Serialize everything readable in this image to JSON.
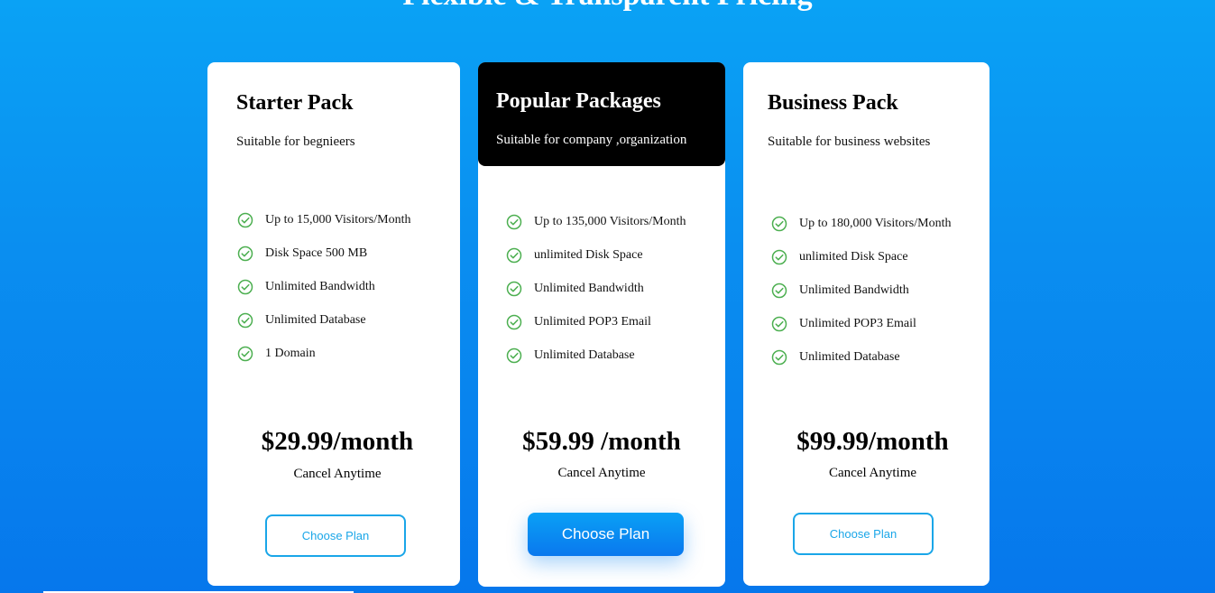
{
  "page": {
    "heading": "Flexible & Transparent Pricing"
  },
  "plans": [
    {
      "title": "Starter Pack",
      "description": "Suitable for begnieers",
      "features": [
        "Up to 15,000 Visitors/Month",
        "Disk Space 500 MB",
        "Unlimited Bandwidth",
        "Unlimited Database",
        "1 Domain"
      ],
      "price": "$29.99/month",
      "cancel_note": "Cancel Anytime",
      "button_label": "Choose Plan"
    },
    {
      "title": "Popular Packages",
      "description": "Suitable for company ,organization",
      "features": [
        "Up to 135,000 Visitors/Month",
        "unlimited Disk Space",
        "Unlimited Bandwidth",
        "Unlimited POP3 Email",
        "Unlimited Database"
      ],
      "price": "$59.99 /month",
      "cancel_note": "Cancel Anytime",
      "button_label": "Choose Plan",
      "highlighted": true
    },
    {
      "title": "Business Pack",
      "description": "Suitable for business websites",
      "features": [
        "Up to 180,000 Visitors/Month",
        "unlimited Disk Space",
        "Unlimited Bandwidth",
        "Unlimited POP3 Email",
        "Unlimited Database"
      ],
      "price": "$99.99/month",
      "cancel_note": "Cancel Anytime",
      "button_label": "Choose Plan"
    }
  ],
  "icons": {
    "feature_icon": "check-circle-icon"
  },
  "colors": {
    "background_top": "#0aa2f5",
    "background_bottom": "#0677ec",
    "check_green": "#4caf50",
    "button_accent": "#1aa6e8",
    "popular_header": "#000000"
  }
}
